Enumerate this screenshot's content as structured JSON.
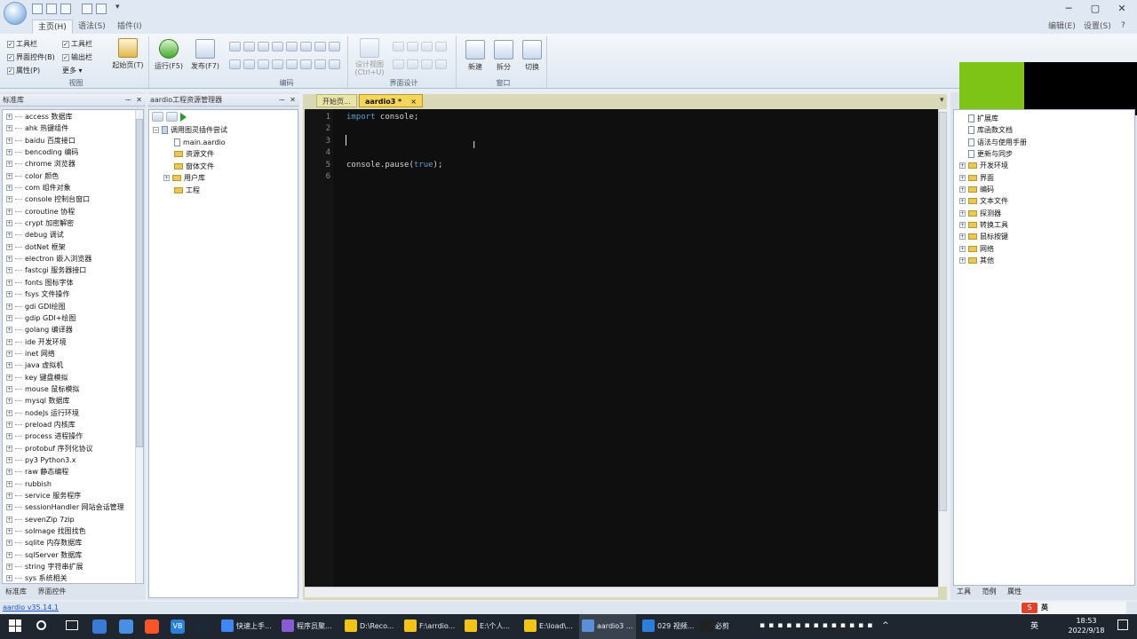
{
  "ribbon": {
    "tabs": [
      "主页(H)",
      "语法(S)",
      "插件(I)"
    ],
    "right_menu": [
      "编辑(E)",
      "设置(S)"
    ],
    "view_checks": [
      "工具栏",
      "界面控件(B)",
      "属性(P)"
    ],
    "view_side": [
      "工具栏",
      "输出栏",
      "更多"
    ],
    "groups": {
      "view": "视图",
      "code": "编码",
      "ui": "界面设计",
      "window": "窗口"
    },
    "buttons": {
      "start_page": "起始页(T)",
      "run": "运行(F5)",
      "publish": "发布(F7)",
      "design": "设计视图\n(Ctrl+U)",
      "new": "新建",
      "split": "拆分",
      "switch": "切换"
    }
  },
  "left_panel": {
    "title": "标准库",
    "items": [
      "access 数据库",
      "ahk 热键组件",
      "baidu 百度接口",
      "bencoding 编码",
      "chrome 浏览器",
      "color 颜色",
      "com 组件对象",
      "console 控制台窗口",
      "coroutine 协程",
      "crypt 加密解密",
      "debug 调试",
      "dotNet 框架",
      "electron 嵌入浏览器",
      "fastcgi 服务器接口",
      "fonts 图标字体",
      "fsys 文件操作",
      "gdi GDI绘图",
      "gdip GDI+绘图",
      "golang 编译器",
      "ide 开发环境",
      "inet 网络",
      "java 虚拟机",
      "key 键盘模拟",
      "mouse 鼠标模拟",
      "mysql 数据库",
      "nodeJs 运行环境",
      "preload 内核库",
      "process 进程操作",
      "protobuf 序列化协议",
      "py3 Python3.x",
      "raw 静态编程",
      "rubbish",
      "service 服务程序",
      "sessionHandler 网站会话管理",
      "sevenZip 7zip",
      "soImage 找图找色",
      "sqlite 内存数据库",
      "sqlServer 数据库",
      "string 字符串扩展",
      "sys 系统相关"
    ],
    "bottom_tabs": [
      "标准库",
      "界面控件"
    ]
  },
  "project_panel": {
    "title": "aardio工程资源管理器",
    "root": "调用图灵插件尝试",
    "items": [
      "main.aardio",
      "资源文件",
      "窗体文件",
      "用户库",
      "工程"
    ]
  },
  "editor": {
    "tabs": [
      "开始页...",
      "aardio3 *"
    ],
    "lines": [
      {
        "n": "1",
        "kw": "import",
        "rest": " console;"
      },
      {
        "n": "2",
        "kw": "",
        "rest": ""
      },
      {
        "n": "3",
        "kw": "",
        "rest": ""
      },
      {
        "n": "4",
        "kw": "",
        "rest": ""
      },
      {
        "n": "5",
        "pre": "console.pause(",
        "arg": "true",
        "post": ");"
      },
      {
        "n": "6",
        "kw": "",
        "rest": ""
      }
    ]
  },
  "right_panel": {
    "items": [
      "扩展库",
      "库函数文档",
      "语法与使用手册",
      "更新与同步",
      "开发环境",
      "界面",
      "编码",
      "文本文件",
      "探测器",
      "转换工具",
      "鼠标按键",
      "网络",
      "其他"
    ],
    "bottom_tabs": [
      "工具",
      "范例",
      "属性"
    ]
  },
  "status": {
    "version": "aardio v35.14.1"
  },
  "taskbar": {
    "apps": [
      "快速上手...",
      "程序员聚...",
      "D:\\Reco...",
      "F:\\arrdio...",
      "E:\\个人...",
      "E:\\load\\...",
      "aardio3 ...",
      "029 视频...",
      "必剪"
    ],
    "ime": "英",
    "time": "18:53",
    "date": "2022/9/18"
  },
  "colors": {
    "editor_bg": "#0f0f0f",
    "keyword": "#5a9fd6",
    "accent_green": "#7dc416"
  }
}
